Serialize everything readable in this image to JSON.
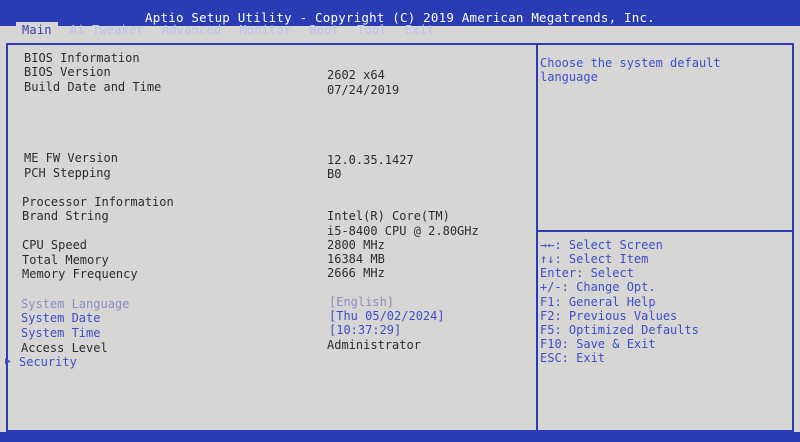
{
  "title": "Aptio Setup Utility - Copyright (C) 2019 American Megatrends, Inc.",
  "tabs": [
    "Main",
    "Ai Tweaker",
    "Advanced",
    "Monitor",
    "Boot",
    "Tool",
    "Exit"
  ],
  "main": {
    "bios_header": "BIOS Information",
    "bios_version_label": "BIOS Version",
    "bios_version_value": "2602  x64",
    "build_date_label": "Build Date and Time",
    "build_date_value": "07/24/2019",
    "me_fw_label": "ME FW Version",
    "me_fw_value": "12.0.35.1427",
    "pch_label": "PCH Stepping",
    "pch_value": "B0",
    "proc_header": "Processor Information",
    "brand_label": "Brand String",
    "brand_value_1": "Intel(R) Core(TM)",
    "brand_value_2": "i5-8400 CPU @ 2.80GHz",
    "cpu_speed_label": "CPU Speed",
    "cpu_speed_value": "2800 MHz",
    "total_mem_label": "Total Memory",
    "total_mem_value": "16384 MB",
    "mem_freq_label": "Memory Frequency",
    "mem_freq_value": " 2666 MHz",
    "sys_lang_label": "System Language",
    "sys_lang_value": "[English]",
    "sys_date_label": "System Date",
    "sys_date_value": "[Thu 05/02/2024]",
    "sys_time_label": "System Time",
    "sys_time_value": "[10:37:29]",
    "access_label": "Access Level",
    "access_value": "Administrator",
    "security_label": "Security"
  },
  "help": {
    "line1": "Choose the system default",
    "line2": "language"
  },
  "keys": [
    "→←: Select Screen",
    "↑↓: Select Item",
    "Enter: Select",
    "+/-: Change Opt.",
    "F1: General Help",
    "F2: Previous Values",
    "F5: Optimized Defaults",
    "F10: Save & Exit",
    "ESC: Exit"
  ]
}
